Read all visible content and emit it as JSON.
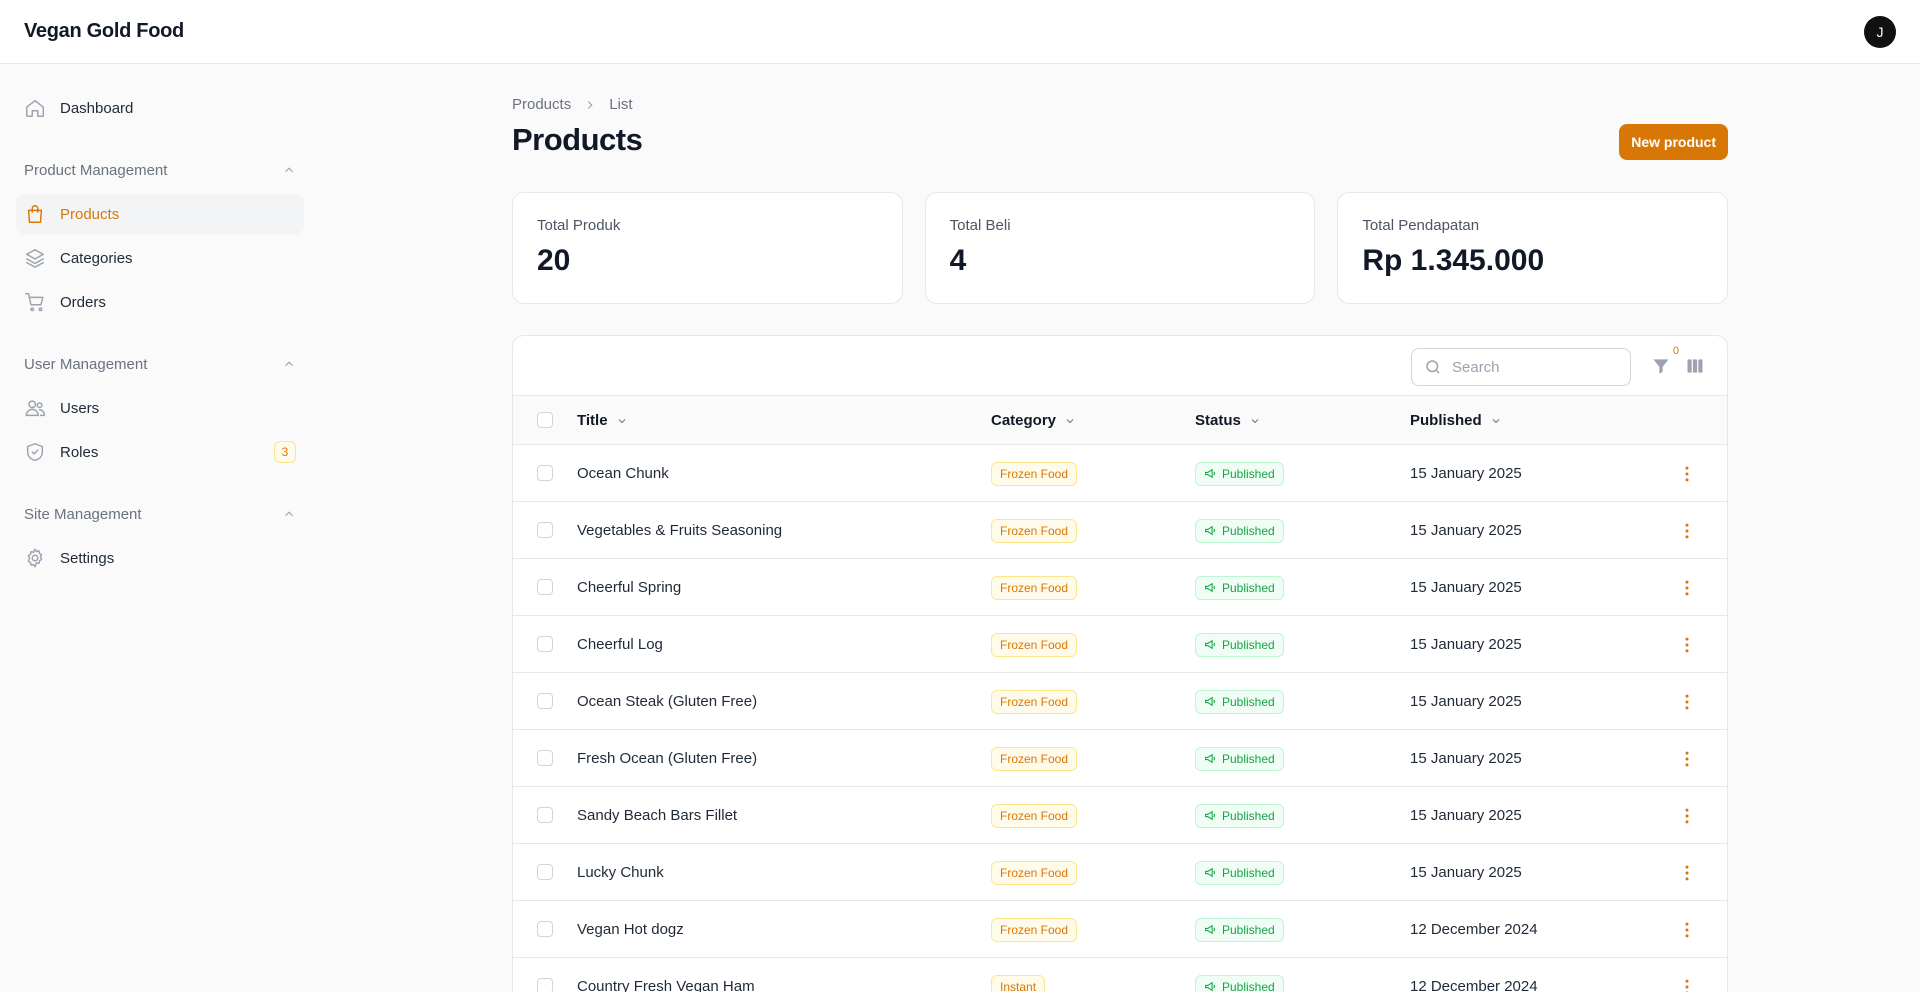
{
  "app": {
    "title": "Vegan Gold Food",
    "avatar_initial": "J"
  },
  "sidebar": {
    "dashboard": "Dashboard",
    "groups": [
      {
        "label": "Product Management",
        "items": [
          {
            "label": "Products",
            "icon": "shopping-bag-icon",
            "active": true
          },
          {
            "label": "Categories",
            "icon": "layers-icon"
          },
          {
            "label": "Orders",
            "icon": "cart-icon"
          }
        ]
      },
      {
        "label": "User Management",
        "items": [
          {
            "label": "Users",
            "icon": "users-icon"
          },
          {
            "label": "Roles",
            "icon": "shield-icon",
            "badge": "3"
          }
        ]
      },
      {
        "label": "Site Management",
        "items": [
          {
            "label": "Settings",
            "icon": "gear-icon"
          }
        ]
      }
    ]
  },
  "breadcrumb": [
    "Products",
    "List"
  ],
  "page": {
    "title": "Products",
    "new_button": "New product"
  },
  "stats": [
    {
      "label": "Total Produk",
      "value": "20"
    },
    {
      "label": "Total Beli",
      "value": "4"
    },
    {
      "label": "Total Pendapatan",
      "value": "Rp 1.345.000"
    }
  ],
  "table": {
    "search_placeholder": "Search",
    "filter_count": "0",
    "columns": [
      "Title",
      "Category",
      "Status",
      "Published"
    ],
    "rows": [
      {
        "title": "Ocean Chunk",
        "category": "Frozen Food",
        "status": "Published",
        "published": "15 January 2025"
      },
      {
        "title": "Vegetables & Fruits Seasoning",
        "category": "Frozen Food",
        "status": "Published",
        "published": "15 January 2025"
      },
      {
        "title": "Cheerful Spring",
        "category": "Frozen Food",
        "status": "Published",
        "published": "15 January 2025"
      },
      {
        "title": "Cheerful Log",
        "category": "Frozen Food",
        "status": "Published",
        "published": "15 January 2025"
      },
      {
        "title": "Ocean Steak (Gluten Free)",
        "category": "Frozen Food",
        "status": "Published",
        "published": "15 January 2025"
      },
      {
        "title": "Fresh Ocean (Gluten Free)",
        "category": "Frozen Food",
        "status": "Published",
        "published": "15 January 2025"
      },
      {
        "title": "Sandy Beach Bars Fillet",
        "category": "Frozen Food",
        "status": "Published",
        "published": "15 January 2025"
      },
      {
        "title": "Lucky Chunk",
        "category": "Frozen Food",
        "status": "Published",
        "published": "15 January 2025"
      },
      {
        "title": "Vegan Hot dogz",
        "category": "Frozen Food",
        "status": "Published",
        "published": "12 December 2024"
      },
      {
        "title": "Country Fresh Vegan Ham",
        "category": "Instant",
        "status": "Published",
        "published": "12 December 2024"
      }
    ]
  }
}
